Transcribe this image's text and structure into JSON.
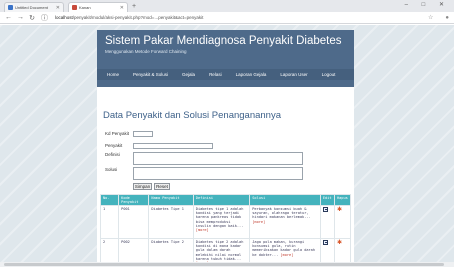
{
  "browser": {
    "tabs": [
      {
        "title": "Untitled Document",
        "active": false
      },
      {
        "title": "Kanan",
        "active": true
      }
    ],
    "new_tab_label": "+",
    "window_controls": "– □ ✕",
    "url_host": "localhost",
    "url_path": "/penyakit/modul/aksi-penyakit.php?mod=...penyakit&act=penyakit"
  },
  "header": {
    "title": "Sistem Pakar Mendiagnosa Penyakit Diabetes",
    "subtitle": "Menggunakan Metode Forward Chaining",
    "menu": [
      "Home",
      "Penyakit & Solusi",
      "Gejala",
      "Relasi",
      "Laporan Gejala",
      "Laporan User",
      "Logout"
    ]
  },
  "main": {
    "section_title": "Data Penyakit dan Solusi Penanganannya",
    "form": {
      "kd_label": "Kd Penyakit",
      "penyakit_label": "Penyakit",
      "definisi_label": "Definisi",
      "solusi_label": "Solusi",
      "kd_value": "",
      "penyakit_value": "",
      "definisi_value": "",
      "solusi_value": "",
      "save_label": "Simpan",
      "reset_label": "Reset"
    },
    "table": {
      "headers": [
        "No.",
        "Kode Penyakit",
        "Nama Penyakit",
        "Definisi",
        "Solusi",
        "Edit",
        "Hapus"
      ],
      "rows": [
        {
          "no": "1",
          "kode": "P001",
          "nama": "Diabetes Tipe 1",
          "definisi": "Diabetes tipe 1 adalah kondisi yang terjadi karena pankreas tidak bisa memproduksi insulin dengan baik...",
          "definisi_more": "[more]",
          "solusi": "Perbanyak konsumsi buah & sayuran, olahraga teratur, hindari makanan berlemak...",
          "solusi_more": "[more]"
        },
        {
          "no": "2",
          "kode": "P002",
          "nama": "Diabetes Tipe 2",
          "definisi": "Diabetes tipe 2 adalah kondisi di mana kadar gula dalam darah melebihi nilai normal karena tubuh tidak...",
          "definisi_more": "[more]",
          "solusi": "Jaga pola makan, kurangi konsumsi gula, rutin memeriksakan kadar gula darah ke dokter...",
          "solusi_more": "[more]"
        }
      ]
    }
  }
}
